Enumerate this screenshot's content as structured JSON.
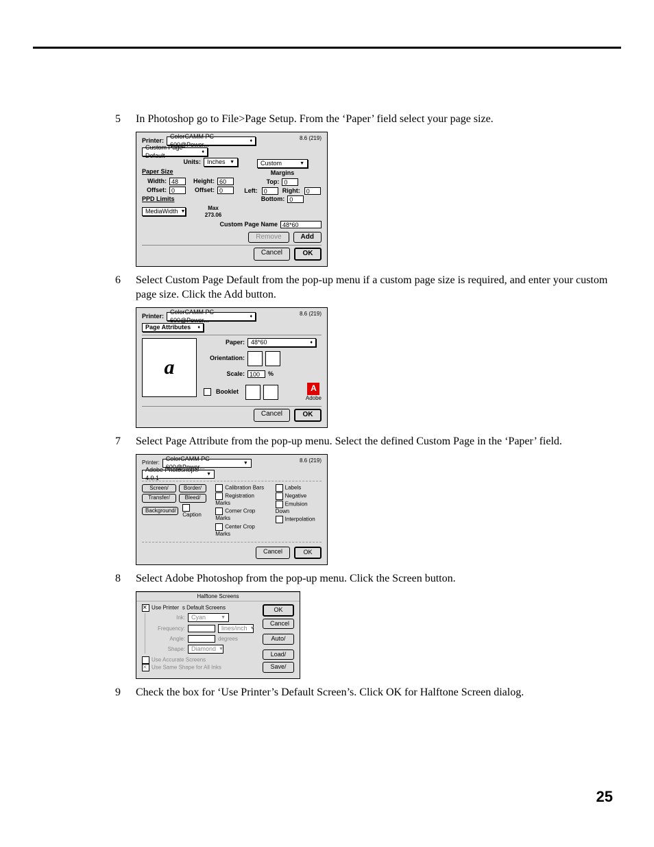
{
  "page_number": "25",
  "steps": {
    "s5": {
      "num": "5",
      "text": "In Photoshop go to File>Page Setup. From the ‘Paper’ field select your page size."
    },
    "s6": {
      "num": "6",
      "text": "Select Custom Page Default from the pop-up menu if a custom page size is required, and enter your custom page size. Click the Add button."
    },
    "s7": {
      "num": "7",
      "text": "Select Page Attribute from the pop-up menu. Select the defined Custom Page in the ‘Paper’ field."
    },
    "s8": {
      "num": "8",
      "text": "Select Adobe Photoshop from the pop-up menu. Click the Screen button."
    },
    "s9": {
      "num": "9",
      "text": "Check the box for ‘Use Printer’s Default Screen’s. Click OK for Halftone Screen dialog."
    }
  },
  "dlg1": {
    "version": "8.6 (219)",
    "printer_label": "Printer:",
    "printer": "ColorCAMM PC-600@Power...",
    "preset": "Custom Page Default",
    "units_label": "Units:",
    "units": "Inches",
    "paper_section": "Paper Size",
    "width_label": "Width:",
    "width": "48",
    "height_label": "Height:",
    "height": "60",
    "woff_label": "Offset:",
    "woff": "0",
    "hoff_label": "Offset:",
    "hoff": "0",
    "custom_label": "Custom",
    "margins_section": "Margins",
    "top_label": "Top:",
    "top": "0",
    "left_label": "Left:",
    "left": "0",
    "right_label": "Right:",
    "right": "0",
    "bottom_label": "Bottom:",
    "bottom": "0",
    "ppd_section": "PPD Limits",
    "media_label": "MediaWidth",
    "max_label": "Max",
    "max_val": "273.06",
    "cpn_label": "Custom Page Name",
    "cpn": "48*60",
    "remove": "Remove",
    "add": "Add",
    "cancel": "Cancel",
    "ok": "OK"
  },
  "dlg2": {
    "version": "8.6 (219)",
    "printer_label": "Printer:",
    "printer": "ColorCAMM PC-600@Power...",
    "preset": "Page Attributes",
    "paper_label": "Paper:",
    "paper": "48*60",
    "orient_label": "Orientation:",
    "scale_label": "Scale:",
    "scale": "100",
    "scale_suffix": "%",
    "booklet": "Booklet",
    "adobe": "Adobe",
    "cancel": "Cancel",
    "ok": "OK"
  },
  "dlg3": {
    "version": "8.6 (219)",
    "printer_label": "Printer:",
    "printer": "ColorCAMM PC-600@Power...",
    "preset": "Adobe Photoshop® 4.0.1",
    "screen": "Screen/",
    "border": "Border/",
    "transfer": "Transfer/",
    "bleed": "Bleed/",
    "background": "Background/",
    "caption": "Caption",
    "c1": "Calibration Bars",
    "c2": "Registration Marks",
    "c3": "Corner Crop Marks",
    "c4": "Center Crop Marks",
    "c5": "Labels",
    "c6": "Negative",
    "c7": "Emulsion Down",
    "c8": "Interpolation",
    "cancel": "Cancel",
    "ok": "OK"
  },
  "dlg4": {
    "title": "Halftone Screens",
    "use_default": "Use Printers Default Screens",
    "ink_label": "Ink:",
    "ink": "Cyan",
    "freq_label": "Frequency:",
    "freq_unit": "lines/inch",
    "angle_label": "Angle:",
    "angle_unit": "degrees",
    "shape_label": "Shape:",
    "shape": "Diamond",
    "accurate": "Use Accurate Screens",
    "same": "Use Same Shape for All Inks",
    "ok": "OK",
    "cancel": "Cancel",
    "auto": "Auto/",
    "load": "Load/",
    "save": "Save/"
  }
}
